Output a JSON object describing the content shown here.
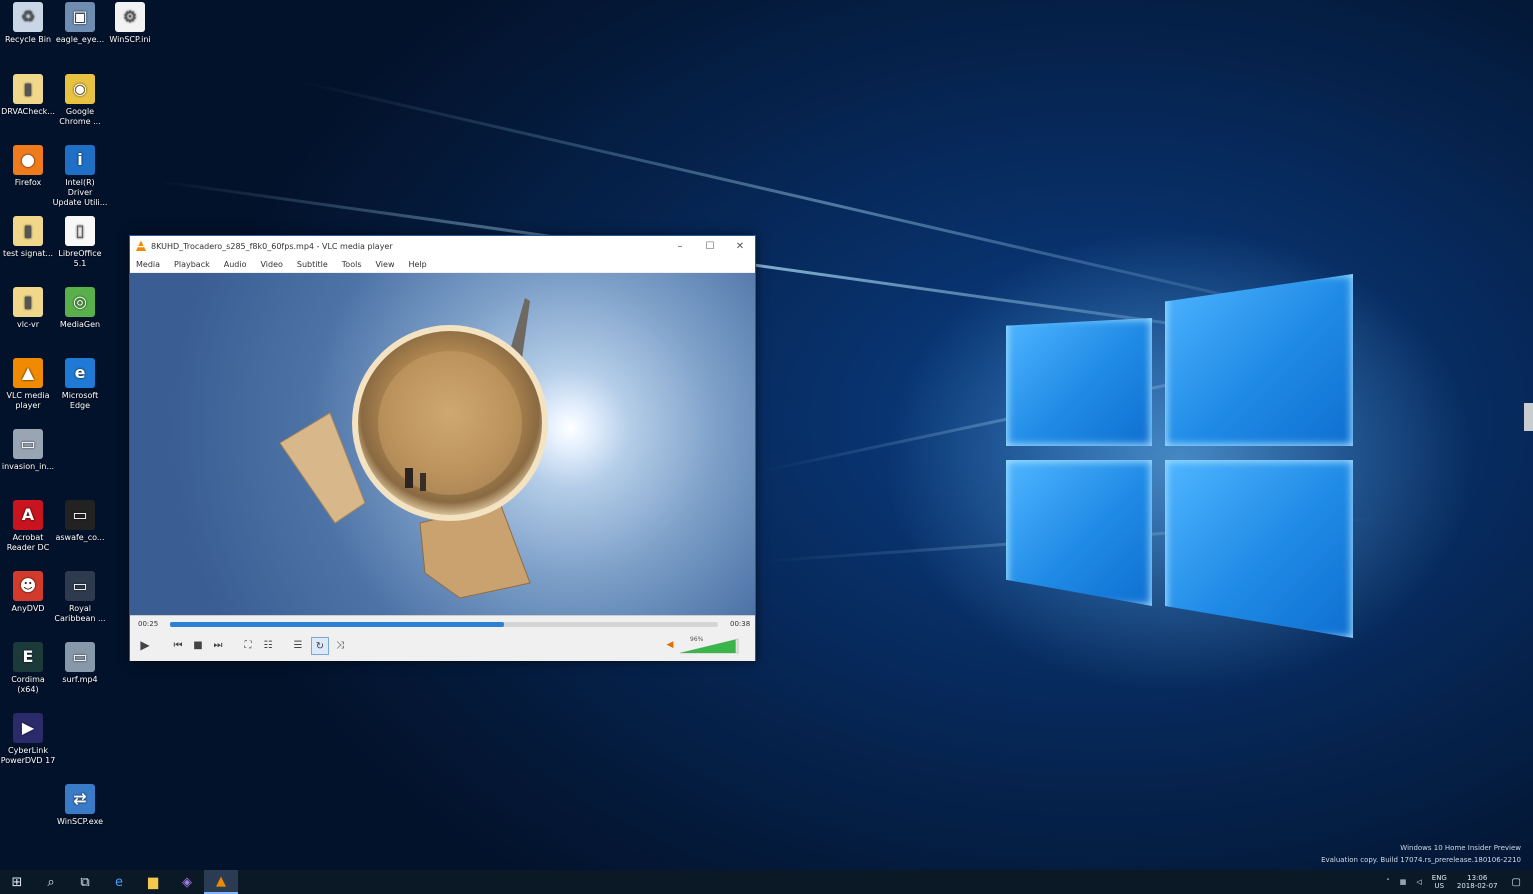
{
  "desktop": {
    "icons": [
      {
        "label": "Recycle Bin",
        "icon": "recycle-bin-icon",
        "glyph": "♻",
        "bg": "#c9d6e6"
      },
      {
        "label": "eagle_eye...",
        "icon": "image-file-icon",
        "glyph": "▣",
        "bg": "#6f8db0"
      },
      {
        "label": "WinSCP.ini",
        "icon": "settings-file-icon",
        "glyph": "⚙",
        "bg": "#f2f2f2"
      },
      {
        "label": "DRVACheck...",
        "icon": "folder-icon",
        "glyph": "▮",
        "bg": "#f1d78a"
      },
      {
        "label": "Google Chrome ...",
        "icon": "chrome-icon",
        "glyph": "◉",
        "bg": "#e8c241"
      },
      {
        "label": "Firefox",
        "icon": "firefox-icon",
        "glyph": "●",
        "bg": "#ef7b1d"
      },
      {
        "label": "Intel(R) Driver Update Utili...",
        "icon": "intel-icon",
        "glyph": "i",
        "bg": "#1f6fc4"
      },
      {
        "label": "test signat...",
        "icon": "folder-icon",
        "glyph": "▮",
        "bg": "#f1d78a"
      },
      {
        "label": "LibreOffice 5.1",
        "icon": "libreoffice-icon",
        "glyph": "▯",
        "bg": "#f8f8f8"
      },
      {
        "label": "vlc-vr",
        "icon": "folder-icon",
        "glyph": "▮",
        "bg": "#f1d78a"
      },
      {
        "label": "MediaGen",
        "icon": "mediagen-icon",
        "glyph": "◎",
        "bg": "#59b04b"
      },
      {
        "label": "VLC media player",
        "icon": "vlc-icon",
        "glyph": "▲",
        "bg": "#f08a00"
      },
      {
        "label": "Microsoft Edge",
        "icon": "edge-icon",
        "glyph": "e",
        "bg": "#1f7ad6"
      },
      {
        "label": "invasion_in...",
        "icon": "video-file-icon",
        "glyph": "▭",
        "bg": "#9aa5b4"
      },
      {
        "label": "Acrobat Reader DC",
        "icon": "acrobat-icon",
        "glyph": "A",
        "bg": "#c8141e"
      },
      {
        "label": "aswafe_co...",
        "icon": "video-file-icon",
        "glyph": "▭",
        "bg": "#222222"
      },
      {
        "label": "AnyDVD",
        "icon": "anydvd-icon",
        "glyph": "☻",
        "bg": "#d23b2b"
      },
      {
        "label": "Royal Caribbean ...",
        "icon": "video-file-icon",
        "glyph": "▭",
        "bg": "#2e3b4e"
      },
      {
        "label": "Cordima (x64)",
        "icon": "cordima-icon",
        "glyph": "E",
        "bg": "#1c3a3a"
      },
      {
        "label": "surf.mp4",
        "icon": "video-file-icon",
        "glyph": "▭",
        "bg": "#8898ab"
      },
      {
        "label": "CyberLink PowerDVD 17",
        "icon": "powerdvd-icon",
        "glyph": "▶",
        "bg": "#2b2b6b"
      },
      {
        "label": "WinSCP.exe",
        "icon": "winscp-icon",
        "glyph": "⇄",
        "bg": "#3a7bc8"
      }
    ]
  },
  "vlc": {
    "title": "8KUHD_Trocadero_s285_f8k0_60fps.mp4 - VLC media player",
    "menu": [
      "Media",
      "Playback",
      "Audio",
      "Video",
      "Subtitle",
      "Tools",
      "View",
      "Help"
    ],
    "time_elapsed": "00:25",
    "time_total": "00:38",
    "progress": 0.61,
    "volume_label": "96%",
    "volume": 0.96
  },
  "taskbar": {
    "items": [
      {
        "icon": "windows-start-icon",
        "glyph": "⊞"
      },
      {
        "icon": "search-icon",
        "glyph": "⌕"
      },
      {
        "icon": "task-view-icon",
        "glyph": "⧉"
      },
      {
        "icon": "edge-icon",
        "glyph": "e"
      },
      {
        "icon": "file-explorer-icon",
        "glyph": "▆"
      },
      {
        "icon": "visual-studio-icon",
        "glyph": "◈"
      },
      {
        "icon": "vlc-icon",
        "glyph": "▲"
      }
    ],
    "tray_lang": "ENG",
    "tray_region": "US",
    "clock_time": "13:06",
    "clock_date": "2018-02-07"
  },
  "watermark": {
    "line1": "Windows 10 Home Insider Preview",
    "line2": "Evaluation copy. Build 17074.rs_prerelease.180106-2210"
  }
}
